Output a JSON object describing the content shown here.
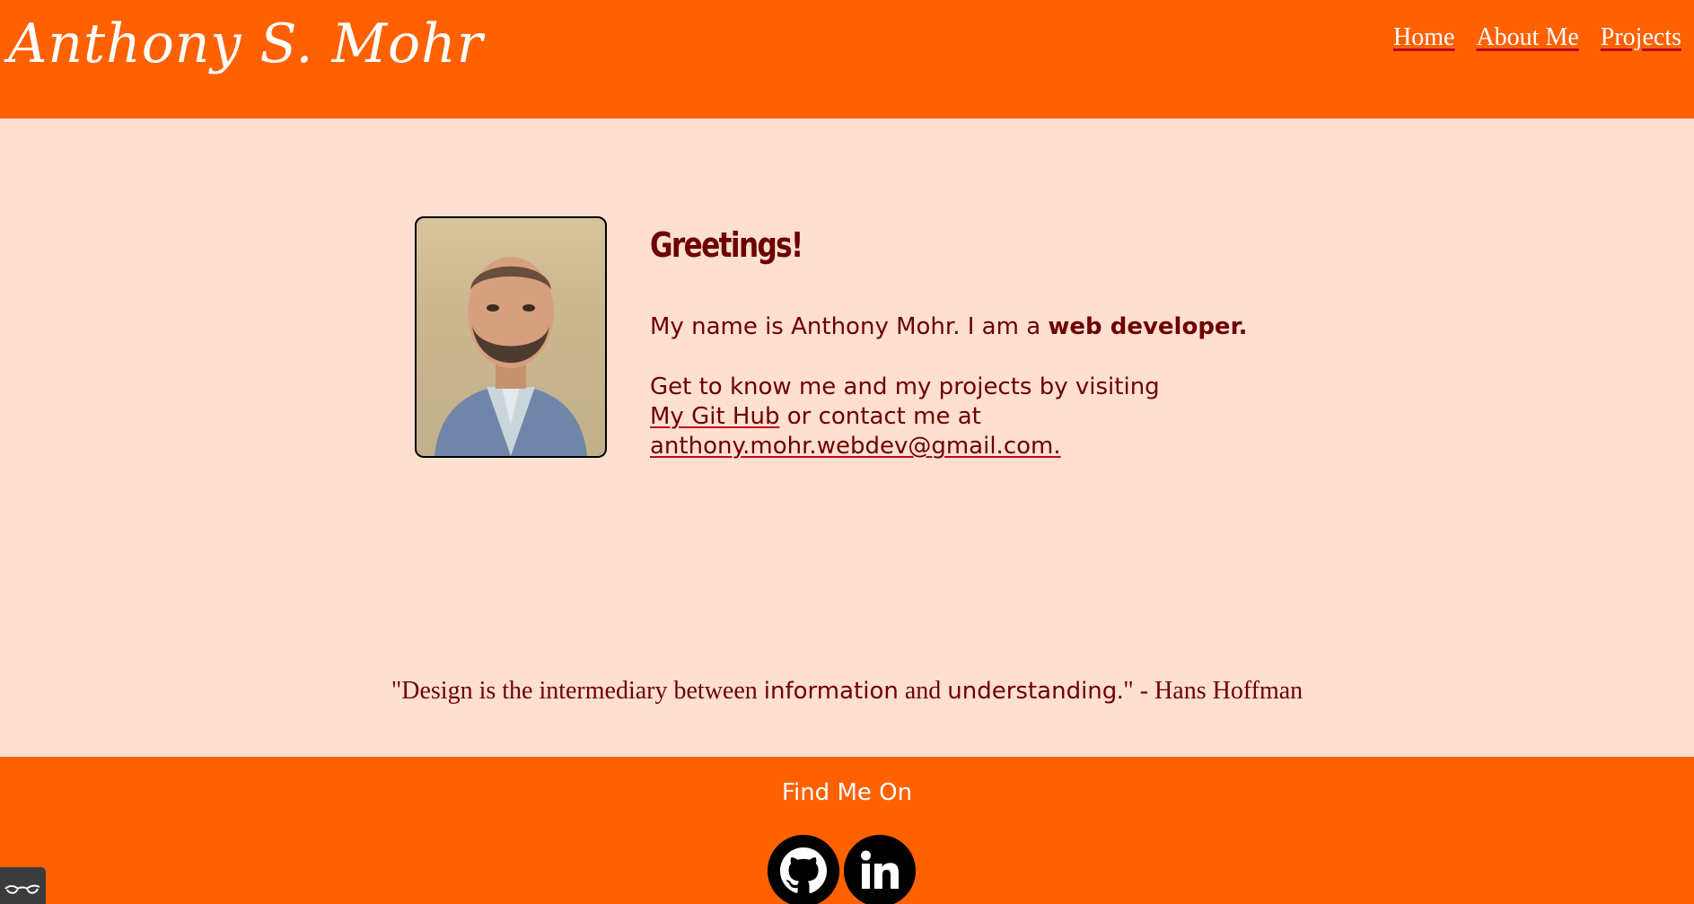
{
  "header": {
    "site_title": "Anthony S. Mohr",
    "nav": [
      {
        "label": "Home"
      },
      {
        "label": "About Me"
      },
      {
        "label": "Projects"
      }
    ]
  },
  "main": {
    "photo_alt": "Photo of Anthony Mohr",
    "greeting": "Greetings!",
    "intro_prefix": "My name is Anthony Mohr. I am a ",
    "intro_emphasis": "web developer.",
    "contact_line1": "Get to know me and my projects by visiting",
    "github_link": "My Git Hub",
    "contact_mid": " or contact me at",
    "email_link": "anthony.mohr.webdev@gmail.com."
  },
  "quote": {
    "part1": "\"Design is the intermediary between ",
    "word1": "information",
    "part2": " and ",
    "word2": "understanding",
    "part3": ".\" - Hans Hoffman"
  },
  "footer": {
    "heading": "Find Me On",
    "social": [
      {
        "name": "github-icon"
      },
      {
        "name": "linkedin-icon"
      }
    ]
  },
  "colors": {
    "brand_orange": "#ff6100",
    "background_peach": "#ffdfd0",
    "text_maroon": "#6d0000",
    "underline_red": "#c3061b"
  }
}
